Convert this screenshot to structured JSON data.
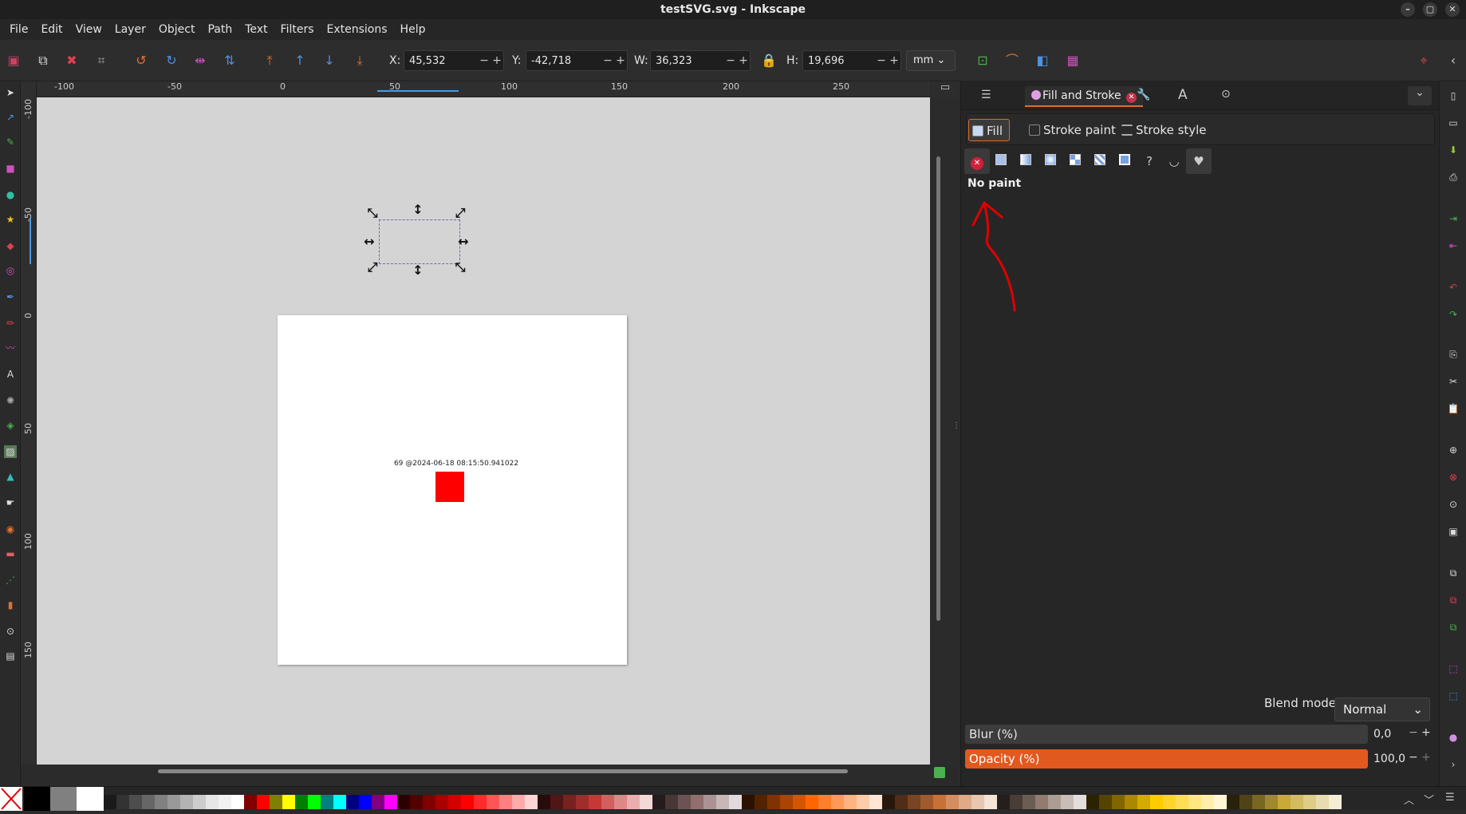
{
  "window": {
    "title": "testSVG.svg - Inkscape"
  },
  "menu": [
    "File",
    "Edit",
    "View",
    "Layer",
    "Object",
    "Path",
    "Text",
    "Filters",
    "Extensions",
    "Help"
  ],
  "toolbar": {
    "x_label": "X:",
    "x_value": "45,532",
    "y_label": "Y:",
    "y_value": "-42,718",
    "w_label": "W:",
    "w_value": "36,323",
    "h_label": "H:",
    "h_value": "19,696",
    "unit": "mm"
  },
  "hruler": [
    "-100",
    "-50",
    "0",
    "50",
    "100",
    "150",
    "200",
    "250"
  ],
  "vruler": [
    "-100",
    "-50",
    "0",
    "50",
    "100",
    "150"
  ],
  "canvas": {
    "page_text": "69 @2024-06-18 08:15:50.941022",
    "red_color": "#ff0000"
  },
  "panel": {
    "tab_title": "Fill and Stroke",
    "fill_tab": "Fill",
    "stroke_paint_tab": "Stroke paint",
    "stroke_style_tab": "Stroke style",
    "paint_types": [
      "no-paint",
      "flat",
      "linear",
      "radial",
      "mesh",
      "pattern",
      "swatch",
      "unset",
      "mask-evenodd",
      "mask-nonzero"
    ],
    "paint_state": "No paint",
    "blend_label": "Blend mode:",
    "blend_value": "Normal",
    "blur_label": "Blur (%)",
    "blur_value": "0,0",
    "opacity_label": "Opacity (%)",
    "opacity_value": "100,0"
  },
  "colors": {
    "accent": "#e06c2c",
    "opacity_bar": "#e2591f",
    "annotation": "#e00000"
  },
  "palette": [
    "#000000",
    "#808080",
    "#ffffff",
    "#1a1a1a",
    "#333333",
    "#4d4d4d",
    "#666666",
    "#808080",
    "#999999",
    "#b3b3b3",
    "#cccccc",
    "#e6e6e6",
    "#f2f2f2",
    "#ffffff",
    "#800000",
    "#ff0000",
    "#808000",
    "#ffff00",
    "#008000",
    "#00ff00",
    "#008080",
    "#00ffff",
    "#000080",
    "#0000ff",
    "#800080",
    "#ff00ff",
    "#2b0000",
    "#550000",
    "#800000",
    "#aa0000",
    "#d40000",
    "#ff0000",
    "#ff2a2a",
    "#ff5555",
    "#ff8080",
    "#ffaaaa",
    "#ffd5d5",
    "#280b0b",
    "#501616",
    "#782121",
    "#a02c2c",
    "#c83737",
    "#d35f5f",
    "#de8787",
    "#e9afaf",
    "#f4d7d7",
    "#241c1c",
    "#483737",
    "#6c5353",
    "#916f6f",
    "#ac9393",
    "#c8b7b7",
    "#e3dbdb",
    "#2b1100",
    "#552200",
    "#803300",
    "#aa4400",
    "#d45500",
    "#ff6600",
    "#ff7f2a",
    "#ff9955",
    "#ffb380",
    "#ffccaa",
    "#ffe6d5",
    "#28170b",
    "#502d16",
    "#784421",
    "#a05a2c",
    "#c87137",
    "#d38d5f",
    "#deaa87",
    "#e9c6af",
    "#f4e3d7",
    "#241f1c",
    "#483e37",
    "#6c5d53",
    "#917c6f",
    "#ac9d93",
    "#c8beb7",
    "#e3dedb",
    "#2b2200",
    "#554400",
    "#806600",
    "#aa8800",
    "#d4aa00",
    "#ffcc00",
    "#ffd42a",
    "#ffdd55",
    "#ffe680",
    "#ffeeaa",
    "#fff6d5",
    "#28220b",
    "#504416",
    "#786721",
    "#a0892c",
    "#c8ab37",
    "#d3bc5f",
    "#decd87",
    "#e9ddaf",
    "#f4eed7"
  ]
}
